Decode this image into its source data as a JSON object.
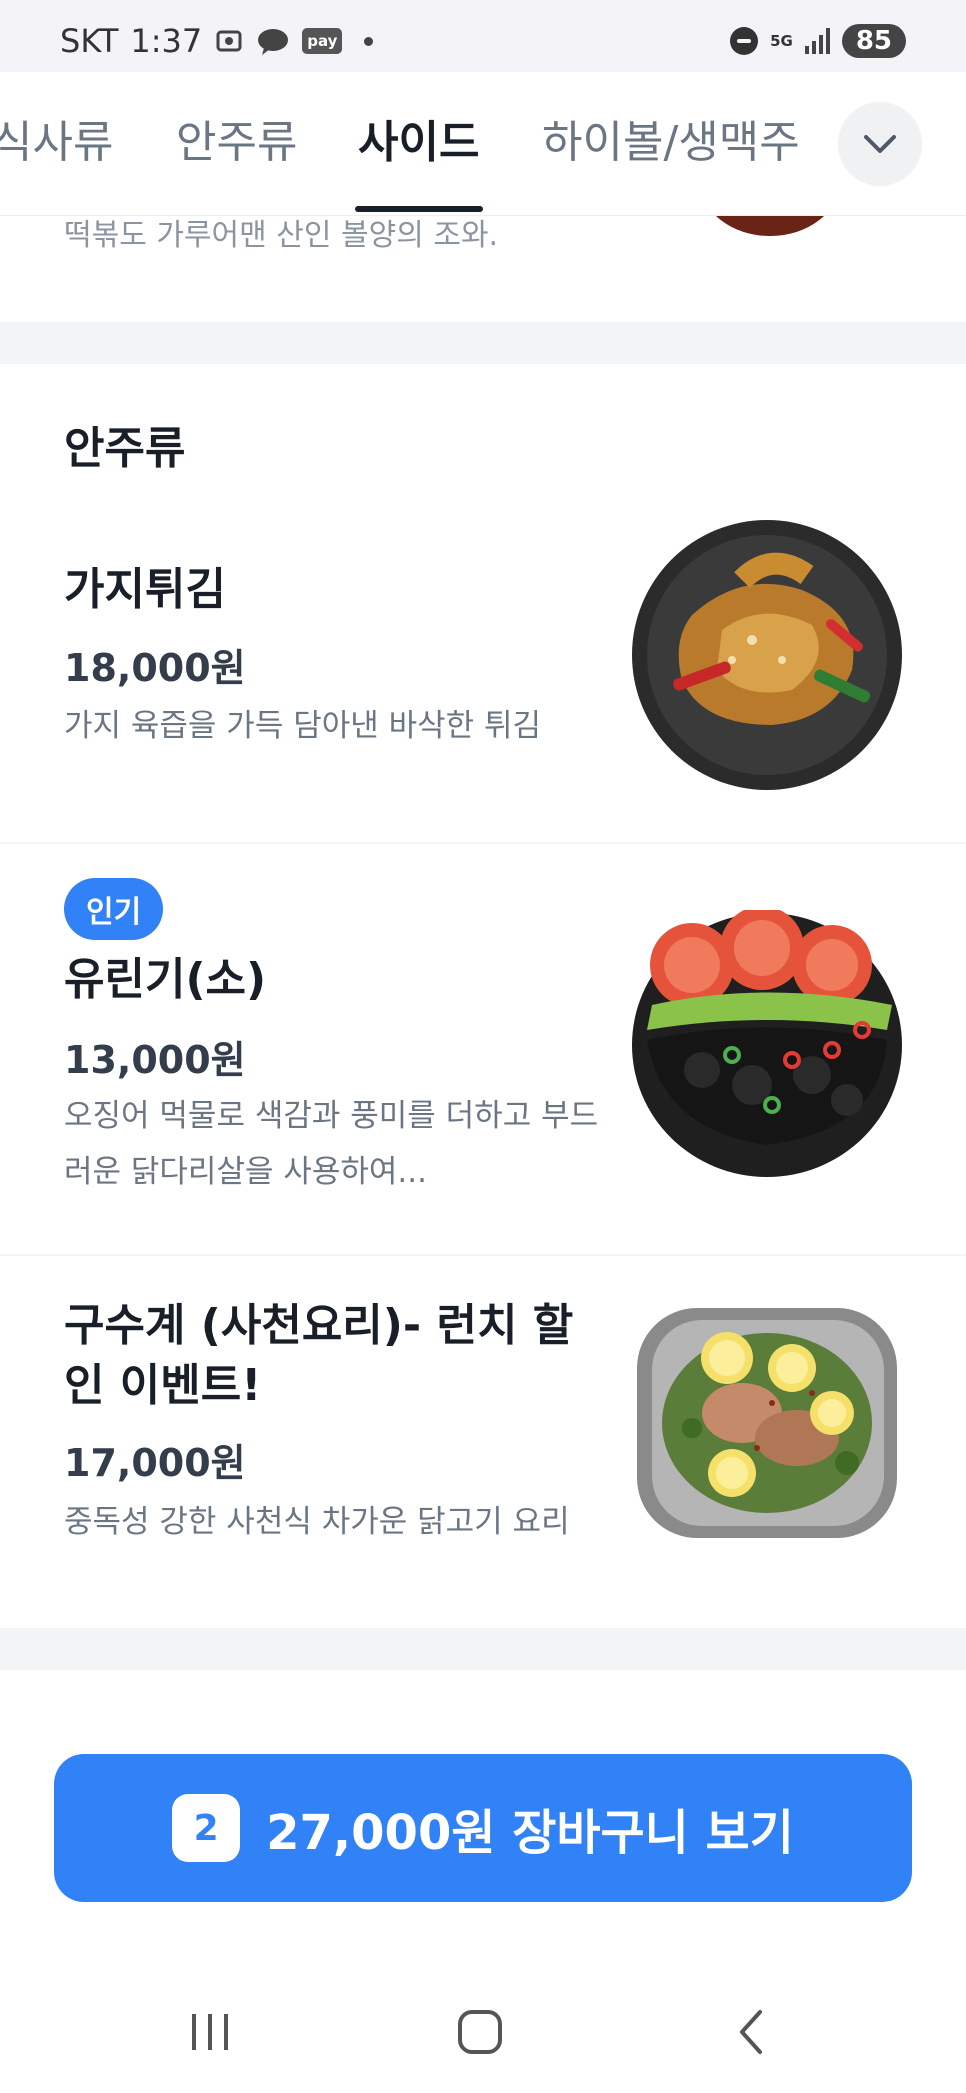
{
  "status_bar": {
    "carrier": "SKT",
    "time": "1:37",
    "pay_label": "pay",
    "network": "5G",
    "battery": "85"
  },
  "tabs": [
    {
      "label": "식사류",
      "active": false
    },
    {
      "label": "안주류",
      "active": false
    },
    {
      "label": "사이드",
      "active": true
    },
    {
      "label": "하이볼/생맥주",
      "active": false
    }
  ],
  "cut_item_desc": "떡볶도 가루어맨 산인 볼양의 조와.",
  "section": {
    "title": "안주류",
    "items": [
      {
        "badge": "",
        "name": "가지튀김",
        "price": "18,000원",
        "desc": "가지 육즙을 가득 담아낸 바삭한 튀김"
      },
      {
        "badge": "인기",
        "name": "유린기(소)",
        "price": "13,000원",
        "desc": "오징어 먹물로 색감과 풍미를 더하고 부드러운 닭다리살을 사용하여..."
      },
      {
        "badge": "",
        "name": "구수계 (사천요리)- 런치 할인 이벤트!",
        "price": "17,000원",
        "desc": "중독성 강한 사천식 차가운 닭고기 요리"
      }
    ]
  },
  "cart": {
    "count": "2",
    "label": "27,000원 장바구니 보기"
  },
  "colors": {
    "accent": "#3182f6",
    "text_primary": "#191f28",
    "text_secondary": "#6b7684",
    "separator": "#f2f4f6"
  }
}
